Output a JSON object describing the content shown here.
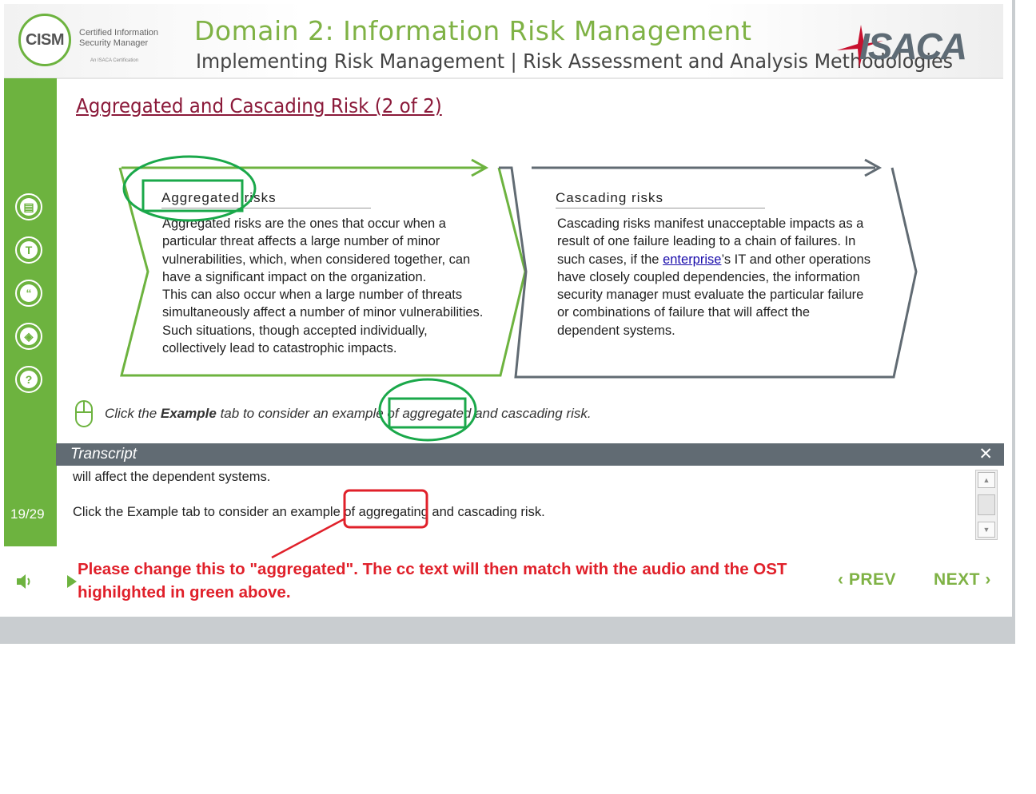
{
  "header": {
    "logo_badge": "CISM",
    "logo_line1": "Certified Information",
    "logo_line2": "Security Manager",
    "logo_tag": "An ISACA Certification",
    "domain_title": "Domain 2: Information Risk Management",
    "subtitle": "Implementing Risk Management | Risk Assessment and Analysis Methodologies",
    "brand": "ISACA"
  },
  "sidebar": {
    "buttons": [
      {
        "icon": "notes-icon",
        "glyph": "▤"
      },
      {
        "icon": "glossary-t-icon",
        "glyph": "T"
      },
      {
        "icon": "quote-icon",
        "glyph": "“"
      },
      {
        "icon": "layers-icon",
        "glyph": "◈"
      },
      {
        "icon": "help-icon",
        "glyph": "?"
      }
    ],
    "page_counter": "19/29"
  },
  "slide": {
    "title": "Aggregated and Cascading Risk (2 of 2)",
    "aggregated": {
      "heading": "Aggregated risks",
      "lines": [
        "Aggregated risks are the ones that occur when a",
        "particular threat affects a large number of minor",
        "vulnerabilities, which, when considered together, can",
        "have a significant impact on the organization.",
        "This can also occur when a large number of threats",
        "simultaneously affect a number of minor vulnerabilities.",
        "Such situations, though accepted individually,",
        "collectively lead to catastrophic impacts."
      ]
    },
    "cascading": {
      "heading": "Cascading risks",
      "line1": "Cascading risks manifest unacceptable impacts as a",
      "line2": "result of one failure leading to a chain of failures. In",
      "line3_pre": "such cases, if the ",
      "line3_link": "enterprise",
      "line3_post": "’s IT and other operations",
      "line4": "have closely coupled dependencies, the information",
      "line5": "security manager must evaluate the particular failure",
      "line6": "or combinations of failure that will affect the",
      "line7": "dependent systems."
    },
    "instruction_pre": "Click the ",
    "instruction_bold": "Example",
    "instruction_post": " tab to consider an example of aggregated and cascading risk."
  },
  "transcript": {
    "title": "Transcript",
    "close": "✕",
    "line1": "will affect the dependent systems.",
    "line2": "Click the Example tab to consider an example of aggregating and cascading risk."
  },
  "footer": {
    "prev": "PREV",
    "next": "NEXT"
  },
  "annotation": {
    "text": "Please change this to \"aggregated\". The cc text will then match with the audio and the OST highilghted in green above."
  },
  "colors": {
    "green": "#6db33f",
    "title_maroon": "#8b1a3a",
    "gray_dark": "#616b73",
    "annotation_red": "#e0202a",
    "highlight_green": "#1aa84a"
  }
}
